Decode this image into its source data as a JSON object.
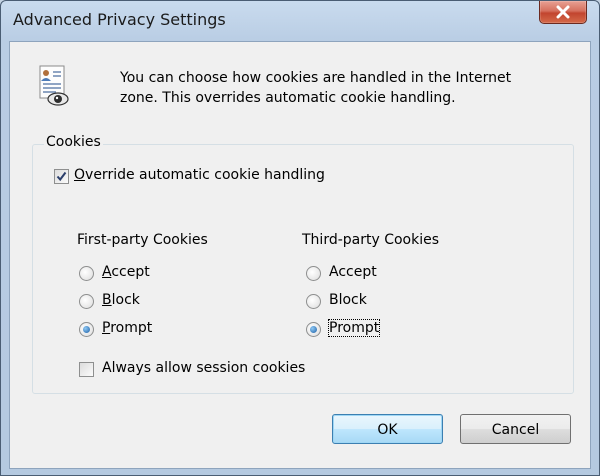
{
  "window": {
    "title": "Advanced Privacy Settings"
  },
  "info": {
    "icon": "privacy-document-eye-icon",
    "text": "You can choose how cookies are handled in the Internet\nzone.  This overrides automatic cookie handling."
  },
  "cookies_group": {
    "label": "Cookies",
    "override": {
      "label": "Override automatic cookie handling",
      "checked": true
    },
    "first_party": {
      "header": "First-party Cookies",
      "options": [
        "Accept",
        "Block",
        "Prompt"
      ],
      "selected": "Prompt"
    },
    "third_party": {
      "header": "Third-party Cookies",
      "options": [
        "Accept",
        "Block",
        "Prompt"
      ],
      "selected": "Prompt"
    },
    "session": {
      "label": "Always allow session cookies",
      "checked": false
    }
  },
  "buttons": {
    "ok": "OK",
    "cancel": "Cancel"
  },
  "colors": {
    "title_bar": "#c9dbee",
    "close_button": "#c2452f",
    "dialog_background": "#f0f0f0",
    "default_button_border": "#3c7fb1"
  }
}
